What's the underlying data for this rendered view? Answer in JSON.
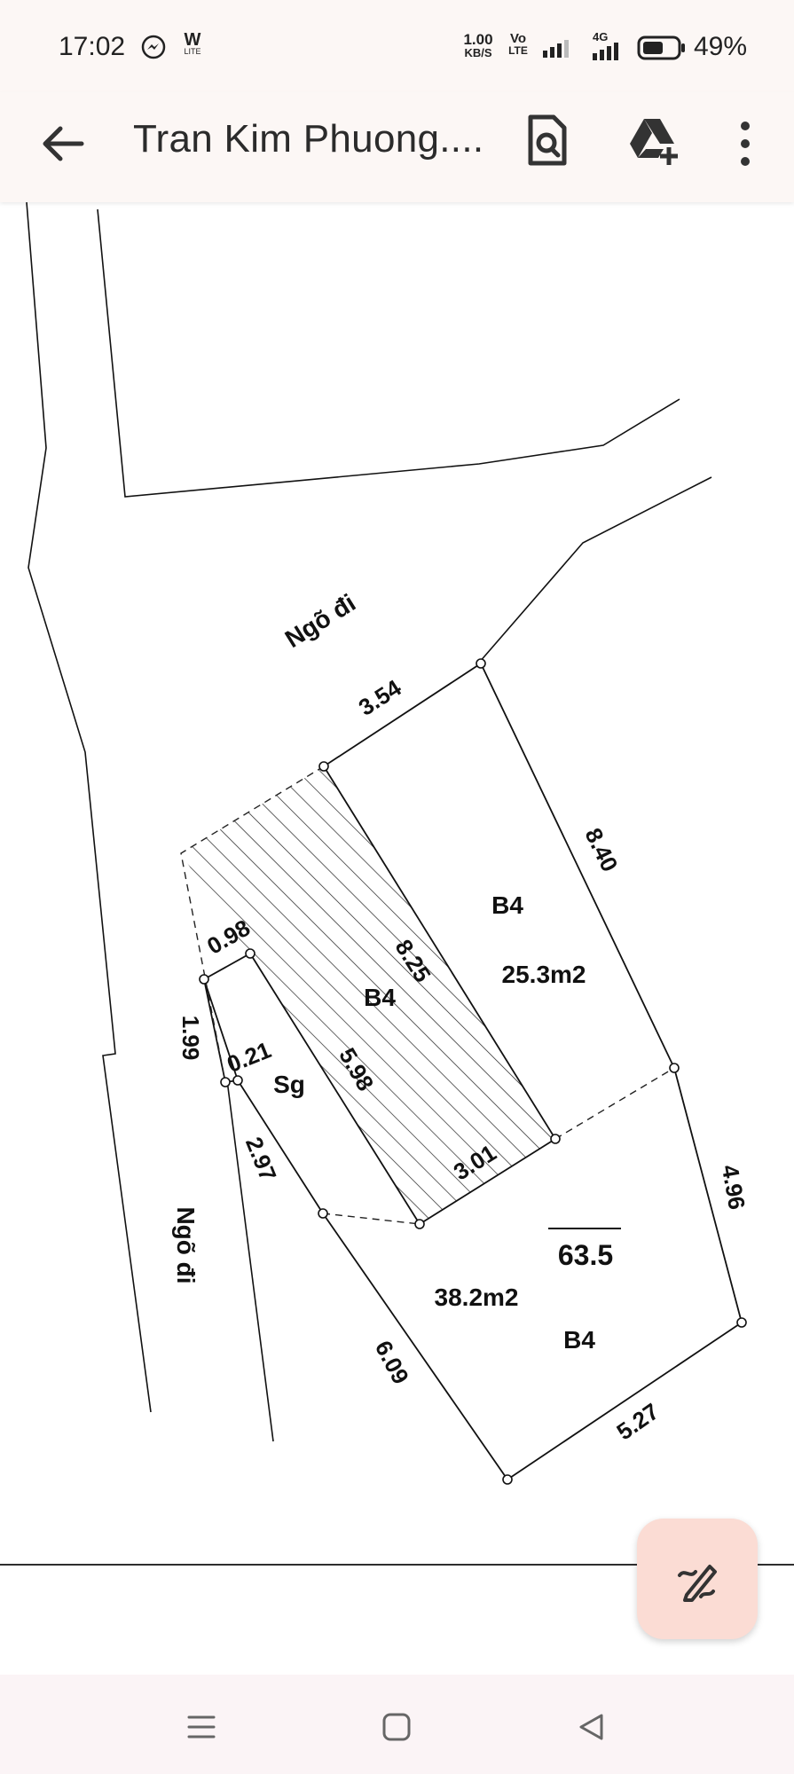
{
  "status_bar": {
    "time": "17:02",
    "speed_value": "1.00",
    "speed_unit": "KB/S",
    "volte_top": "Vo",
    "volte_bottom": "LTE",
    "network": "4G",
    "battery": "49%",
    "w_lite_top": "W",
    "w_lite_bottom": "LITE"
  },
  "app_bar": {
    "title": "Tran Kim Phuong....",
    "icons": [
      "back-arrow-icon",
      "search-document-icon",
      "add-to-drive-icon",
      "more-vert-icon"
    ]
  },
  "plan": {
    "road_label_top": "Ngõ đi",
    "road_label_left": "Ngõ đi",
    "dim_354": "3.54",
    "dim_840": "8.40",
    "dim_098": "0.98",
    "dim_825": "8.25",
    "dim_199": "1.99",
    "dim_021": "0.21",
    "dim_598": "5.98",
    "dim_297": "2.97",
    "dim_301": "3.01",
    "dim_496": "4.96",
    "dim_609": "6.09",
    "dim_527": "5.27",
    "zone_b4_top": "B4",
    "area_top": "25.3m2",
    "zone_b4_hatched": "B4",
    "zone_sg": "Sg",
    "parcel_number": "63.5",
    "area_bottom": "38.2m2",
    "zone_b4_bottom": "B4"
  },
  "fab": {
    "icon": "edit-pencil-icon"
  },
  "nav_bar": {
    "icons": [
      "recents-icon",
      "home-icon",
      "back-icon"
    ]
  }
}
